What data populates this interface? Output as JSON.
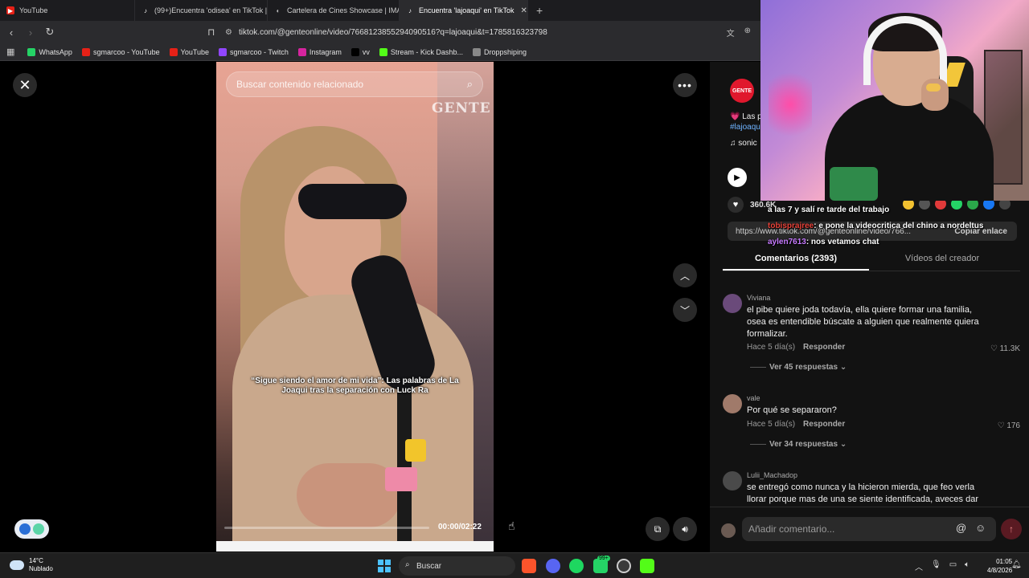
{
  "browser": {
    "tabs": [
      {
        "title": "YouTube",
        "icon": "youtube-icon"
      },
      {
        "title": "(99+)Encuentra 'odisea' en TikTok | B",
        "icon": "tiktok-icon"
      },
      {
        "title": "Cartelera de Cines Showcase | IMAX",
        "icon": "cinema-icon"
      },
      {
        "title": "Encuentra 'lajoaqui' en TikTok",
        "icon": "tiktok-icon"
      }
    ],
    "url": "tiktok.com/@genteonline/video/7668123855294090516?q=lajoaqui&t=1785816323798",
    "bookmarks": [
      {
        "label": "WhatsApp",
        "color": "#25d366"
      },
      {
        "label": "sgmarcoo - YouTube",
        "color": "#e62117"
      },
      {
        "label": "YouTube",
        "color": "#e62117"
      },
      {
        "label": "sgmarcoo - Twitch",
        "color": "#9146ff"
      },
      {
        "label": "Instagram",
        "color": "#d6249f"
      },
      {
        "label": "vv",
        "color": "#000000"
      },
      {
        "label": "Stream - Kick Dashb...",
        "color": "#53fc18"
      },
      {
        "label": "Droppshiping",
        "color": "#888888"
      }
    ]
  },
  "video": {
    "search_placeholder": "Buscar contenido relacionado",
    "watermark": "GENTE",
    "caption": "“Sigue siendo el amor de mi vida”: Las palabras de La Joaqui tras la separación con Luck Ra",
    "time": "00:00/02:22",
    "progress": 0.0
  },
  "panel": {
    "account_avatar": "GENTE",
    "description_line1": "💗 Las p",
    "description_line2": "#lajoaqu",
    "sound": "♫  sonic",
    "likes": "360.6K",
    "link": "https://www.tiktok.com/@genteonline/video/766...",
    "copy_link": "Copiar enlace",
    "tab_comments": "Comentarios (2393)",
    "tab_creator": "Vídeos del creador",
    "comments": [
      {
        "user": "Viviana",
        "text": "el pibe quiere joda todavía, ella quiere formar una familia, osea es entendible búscate a alguien que realmente quiera formalizar.",
        "time": "Hace 5 día(s)",
        "reply": "Responder",
        "likes": "11.3K",
        "replies": "Ver 45 respuestas",
        "avatar_color": "#6a4a7a"
      },
      {
        "user": "vale",
        "text": "Por qué se separaron?",
        "time": "Hace 5 día(s)",
        "reply": "Responder",
        "likes": "176",
        "replies": "Ver 34 respuestas",
        "avatar_color": "#a07a6a"
      },
      {
        "user": "Lulii_Machadop",
        "text": "se entregó como nunca y la hicieron mierda, que feo verla llorar porque mas de una se siente identificada, aveces dar",
        "avatar_color": "#4a4a4a"
      }
    ],
    "composer_placeholder": "Añadir comentario..."
  },
  "chat": [
    {
      "user": "",
      "message": "a las 7 y salí re tarde del trabajo"
    },
    {
      "user": "tobisprajree",
      "message": ": e pone la videocritica del chino a nordeltus"
    },
    {
      "user": "aylen7613",
      "message": ": nos vetamos chat"
    }
  ],
  "taskbar": {
    "temperature": "14°C",
    "weather": "Nublado",
    "search": "Buscar",
    "time": "01:05",
    "date": "4/8/2026",
    "badge": "99+"
  }
}
